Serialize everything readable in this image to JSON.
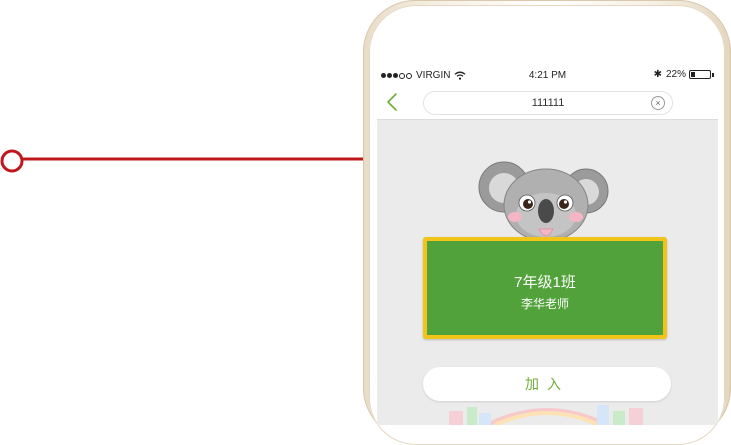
{
  "status_bar": {
    "carrier": "VIRGIN",
    "time": "4:21 PM",
    "bluetooth": "✱",
    "battery_percent": "22%",
    "battery_level": 0.22
  },
  "nav": {
    "back_icon": "chevron-left-icon",
    "search_value": "111111",
    "clear_icon": "×"
  },
  "card": {
    "class_name": "7年级1班",
    "teacher_name": "李华老师"
  },
  "join_button_label": "加入",
  "colors": {
    "accent_green": "#6fae3a",
    "board_green": "#52a23b",
    "board_border": "#f2c318",
    "callout_red": "#c0171d"
  }
}
